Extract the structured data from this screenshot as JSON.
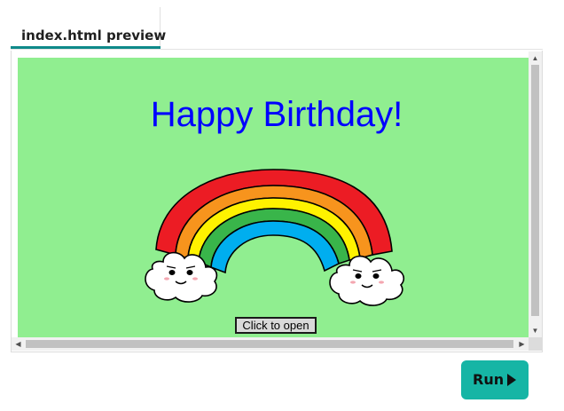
{
  "tab": {
    "label": "index.html preview",
    "active": true,
    "accent_color": "#0f8a8a"
  },
  "preview": {
    "background_color": "#90ee90",
    "heading": "Happy Birthday!",
    "heading_color": "#0000ff",
    "open_button_label": "Click to open",
    "illustration": "rainbow-with-smiling-clouds-icon",
    "rainbow_colors": [
      "#ec1c24",
      "#f7941d",
      "#fff200",
      "#39b54a",
      "#00aeef"
    ]
  },
  "scrollbars": {
    "vertical": {
      "up_icon": "arrow-up-icon",
      "down_icon": "arrow-down-icon"
    },
    "horizontal": {
      "left_icon": "arrow-left-icon",
      "right_icon": "arrow-right-icon"
    }
  },
  "run_button": {
    "label": "Run",
    "icon": "play-icon",
    "color": "#16b5a5"
  }
}
